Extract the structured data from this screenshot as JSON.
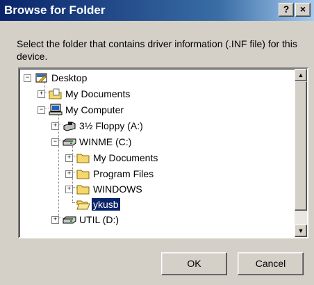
{
  "window": {
    "title": "Browse for Folder",
    "help_button": "?",
    "close_button": "×"
  },
  "instruction": "Select the folder that contains driver information (.INF file) for this device.",
  "tree": {
    "items": [
      {
        "label": "Desktop",
        "icon": "desktop-icon",
        "expander": "−"
      },
      {
        "label": "My Documents",
        "icon": "my-documents-icon",
        "expander": "+"
      },
      {
        "label": "My Computer",
        "icon": "my-computer-icon",
        "expander": "−"
      },
      {
        "label": "3½ Floppy (A:)",
        "icon": "floppy-drive-icon",
        "expander": "+"
      },
      {
        "label": "WINME (C:)",
        "icon": "hard-drive-icon",
        "expander": "−"
      },
      {
        "label": "My Documents",
        "icon": "folder-icon",
        "expander": "+"
      },
      {
        "label": "Program Files",
        "icon": "folder-icon",
        "expander": "+"
      },
      {
        "label": "WINDOWS",
        "icon": "folder-icon",
        "expander": "+"
      },
      {
        "label": "ykusb",
        "icon": "open-folder-icon",
        "expander": "",
        "selected": true
      },
      {
        "label": "UTIL (D:)",
        "icon": "hard-drive-icon",
        "expander": "+"
      }
    ]
  },
  "scrollbar": {
    "up_arrow": "▲",
    "down_arrow": "▼"
  },
  "buttons": {
    "ok": "OK",
    "cancel": "Cancel"
  }
}
